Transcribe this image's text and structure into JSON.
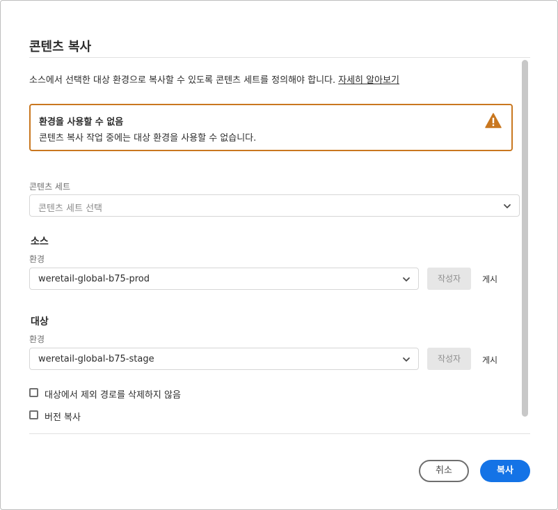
{
  "dialog": {
    "title": "콘텐츠 복사",
    "intro_text": "소스에서 선택한 대상 환경으로 복사할 수 있도록 콘텐츠 세트를 정의해야 합니다.",
    "learn_more_link": "자세히 알아보기"
  },
  "alert": {
    "title": "환경을 사용할 수 없음",
    "message": "콘텐츠 복사 작업 중에는 대상 환경을 사용할 수 없습니다.",
    "icon": "warning-icon",
    "color": "#c9771f"
  },
  "content_set": {
    "label": "콘텐츠 세트",
    "placeholder": "콘텐츠 세트 선택"
  },
  "source": {
    "heading": "소스",
    "env_label": "환경",
    "env_value": "weretail-global-b75-prod",
    "author_button": "작성자",
    "publish_button": "게시"
  },
  "target": {
    "heading": "대상",
    "env_label": "환경",
    "env_value": "weretail-global-b75-stage",
    "author_button": "작성자",
    "publish_button": "게시"
  },
  "options": {
    "no_delete_label": "대상에서 제외 경로를 삭제하지 않음",
    "no_delete_checked": false,
    "copy_versions_label": "버전 복사",
    "copy_versions_checked": false
  },
  "footer": {
    "cancel_label": "취소",
    "copy_label": "복사",
    "accent_color": "#1473e6"
  }
}
